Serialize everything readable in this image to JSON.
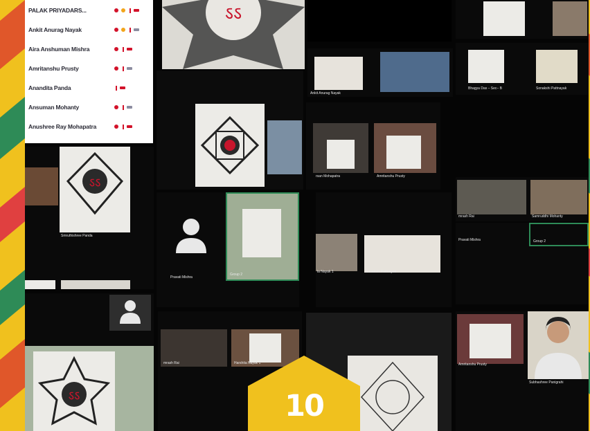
{
  "participants": [
    {
      "name": "PALAK PRIYADARS..."
    },
    {
      "name": "Ankit Anurag Nayak"
    },
    {
      "name": "Aira Anshuman Mishra"
    },
    {
      "name": "Amritanshu Prusty"
    },
    {
      "name": "Anandita Panda"
    },
    {
      "name": "Ansuman Mohanty"
    },
    {
      "name": "Anushree Ray Mohapatra"
    }
  ],
  "tiles": {
    "ankit": "Ankit Anurag Nayak",
    "soumya": "Bhagya Das – Sec– B",
    "sonali": "Sonakshi Pattnayak",
    "samruddha": "Smruthishree Panda",
    "mohap": "rsan Mohapatra",
    "amrit": "Amritanshu Prusty",
    "pravati": "Pravati Mishra",
    "group": "Group 2",
    "nayak": "la Nayak 1",
    "sonakshi": "Sonakshi Pattnayak",
    "pravati2": "Pravati Mishra",
    "group2": "Group 2",
    "mruti": "mrash Rai",
    "harsh": "Harshita Nayak 1",
    "amrit2": "Amritanshu Prusty",
    "subha": "Subhashree Panigrahi",
    "samr2": "Samruddhi Mohanty",
    "mruti2": "mrash Rai"
  },
  "badge": {
    "number": "10",
    "color": "#f0c11e"
  },
  "colors": {
    "frame": "#f0c11e",
    "mute": "#d3122a",
    "hand": "#f2a51c"
  }
}
